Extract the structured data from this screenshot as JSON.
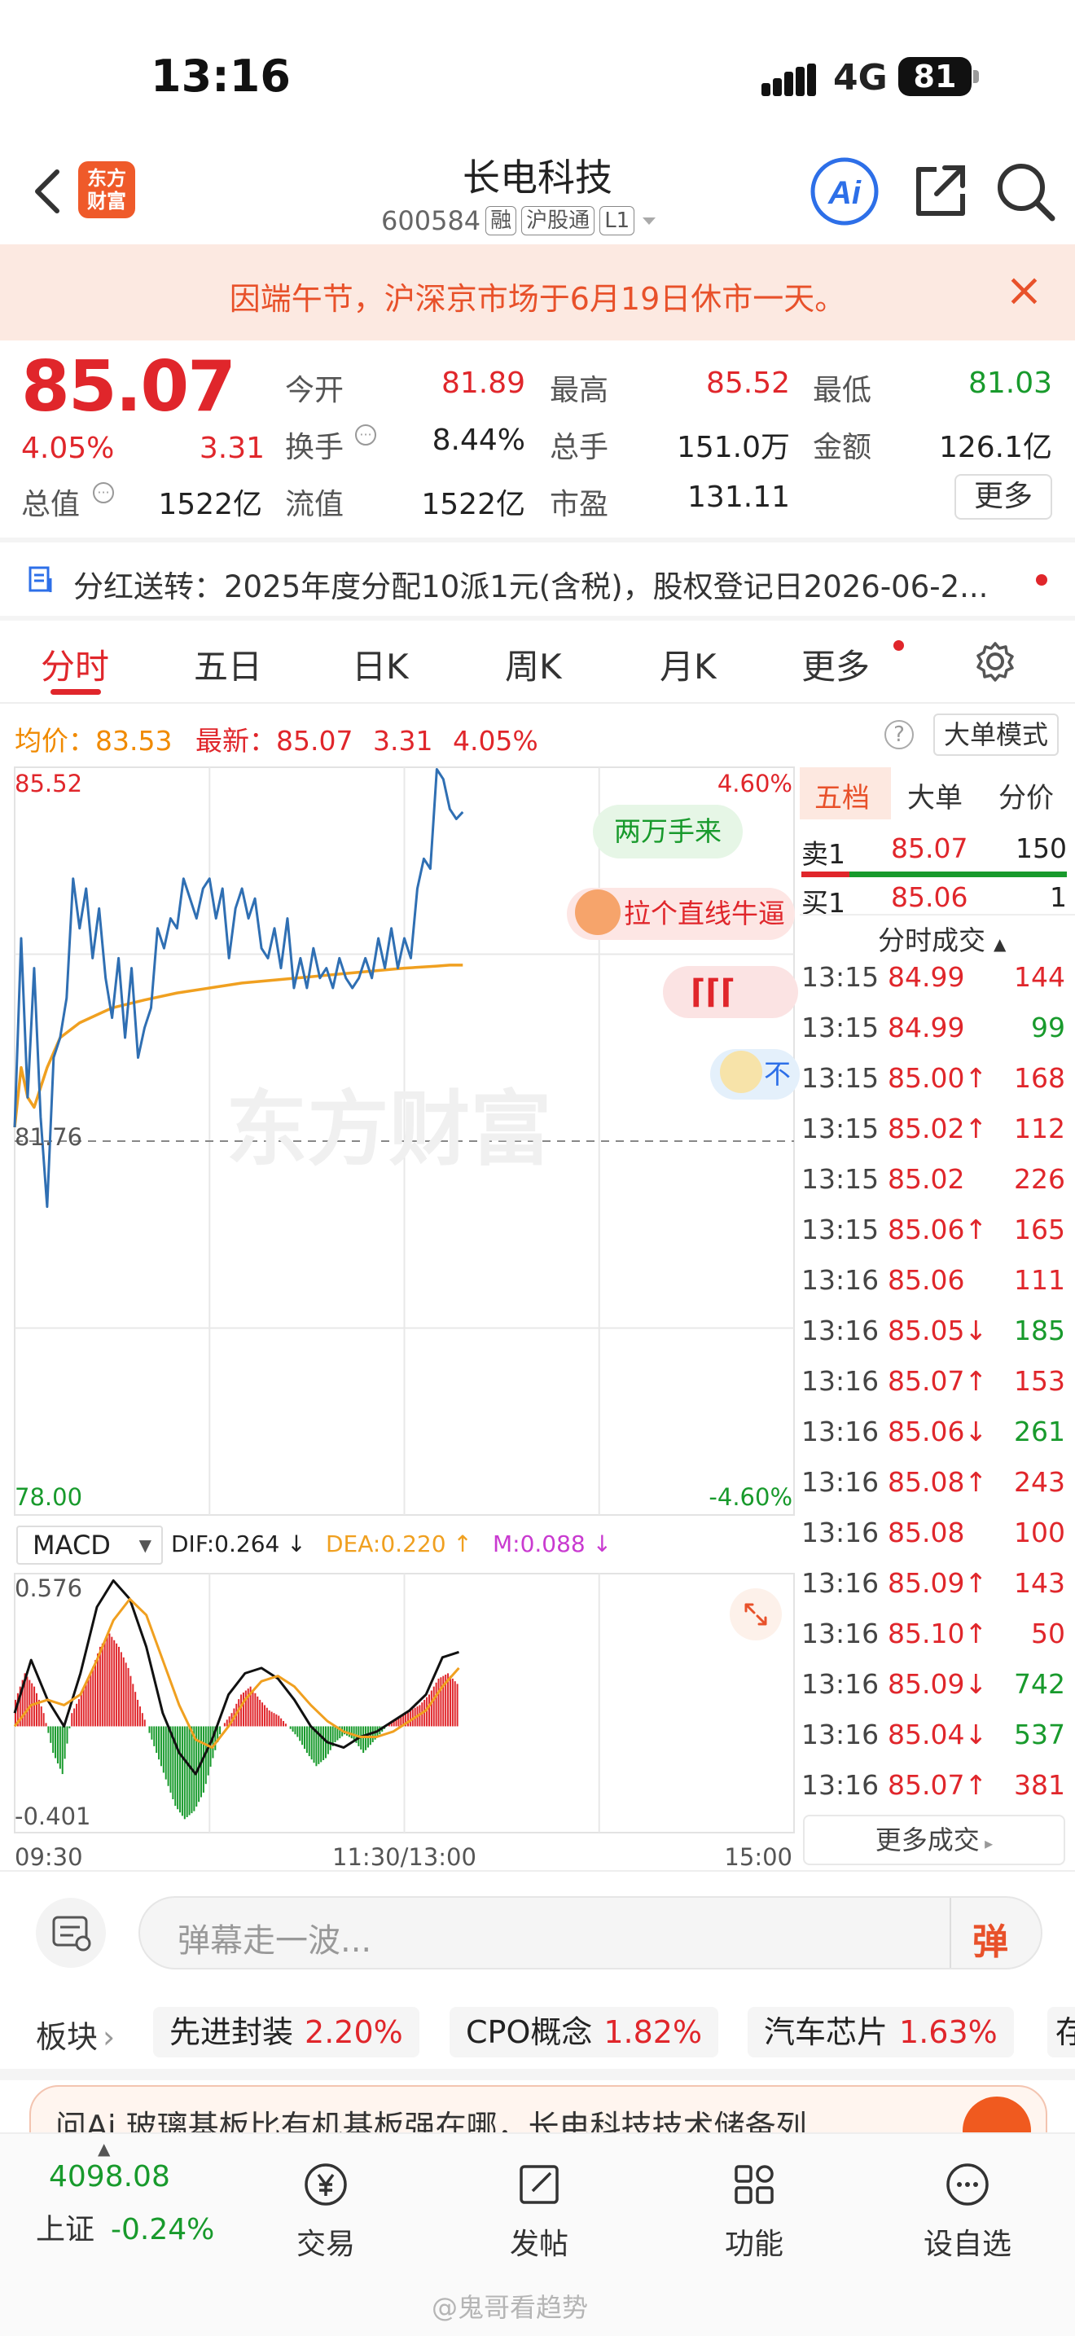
{
  "status_bar": {
    "time": "13:16",
    "network": "4G",
    "battery": "81"
  },
  "header": {
    "logo_line1": "东方",
    "logo_line2": "财富",
    "title": "长电科技",
    "code": "600584",
    "tags": [
      "融",
      "沪股通",
      "L1"
    ]
  },
  "notice": {
    "text": "因端午节，沪深京市场于6月19日休市一天。"
  },
  "quote": {
    "price": "85.07",
    "change_pct": "4.05%",
    "change": "3.31",
    "open_label": "今开",
    "open": "81.89",
    "high_label": "最高",
    "high": "85.52",
    "low_label": "最低",
    "low": "81.03",
    "turnover_label": "换手",
    "turnover": "8.44%",
    "volume_label": "总手",
    "volume": "151.0万",
    "amount_label": "金额",
    "amount": "126.1亿",
    "total_mv_label": "总值",
    "total_mv": "1522亿",
    "float_mv_label": "流值",
    "float_mv": "1522亿",
    "pe_label": "市盈",
    "pe": "131.11",
    "more_label": "更多"
  },
  "dividend": {
    "text": "分红送转：2025年度分配10派1元(含税)，股权登记日2026-06-2..."
  },
  "tabs": [
    "分时",
    "五日",
    "日K",
    "周K",
    "月K",
    "更多"
  ],
  "price_line": {
    "avg_label": "均价：",
    "avg": "83.53",
    "last_label": "最新：",
    "last": "85.07",
    "chg": "3.31",
    "pct": "4.05%",
    "big_order_label": "大单模式"
  },
  "chart_data": [
    {
      "type": "line",
      "x_labels": [
        "09:30",
        "11:30/13:00",
        "15:00"
      ],
      "yleft_labels": {
        "top": "85.52",
        "mid": "81.76",
        "bottom": "78.00"
      },
      "yright_labels": {
        "top": "4.60%",
        "bottom": "-4.60%"
      },
      "ylim": [
        78.0,
        85.52
      ],
      "prev_close": 81.76,
      "watermark": "东方财富",
      "series": [
        {
          "name": "",
          "color": "#2f6fb3",
          "x": [
            0,
            2,
            4,
            6,
            8,
            10,
            12,
            14,
            16,
            18,
            20,
            22,
            24,
            26,
            28,
            30,
            32,
            34,
            36,
            38,
            40,
            42,
            44,
            46,
            48,
            50,
            52,
            54,
            56,
            58,
            60,
            62,
            64,
            66,
            68,
            70,
            72,
            74,
            76,
            78,
            80,
            82,
            84,
            86,
            88,
            90,
            92,
            94,
            96,
            98,
            100,
            102,
            104,
            106,
            108,
            110,
            112,
            114,
            116,
            118,
            120,
            122,
            124,
            126,
            128,
            130,
            132,
            134,
            136,
            138
          ],
          "values": [
            81.9,
            83.8,
            82.2,
            83.5,
            82.0,
            81.1,
            82.6,
            82.8,
            83.2,
            84.4,
            83.9,
            84.3,
            83.6,
            84.1,
            83.4,
            83.0,
            83.6,
            82.8,
            83.5,
            82.6,
            82.9,
            83.1,
            83.9,
            83.7,
            84.0,
            83.9,
            84.4,
            84.2,
            84.0,
            84.3,
            84.4,
            84.0,
            84.3,
            83.6,
            84.1,
            84.3,
            84.0,
            84.2,
            83.7,
            83.6,
            83.9,
            83.5,
            84.0,
            83.3,
            83.6,
            83.3,
            83.7,
            83.4,
            83.5,
            83.3,
            83.6,
            83.4,
            83.3,
            83.4,
            83.6,
            83.4,
            83.8,
            83.5,
            83.9,
            83.5,
            83.8,
            83.6,
            84.3,
            84.6,
            84.5,
            85.5,
            85.4,
            85.1,
            85.0,
            85.07
          ]
        },
        {
          "name": "",
          "color": "#f0a020",
          "x": [
            0,
            2,
            4,
            6,
            8,
            10,
            14,
            20,
            30,
            40,
            50,
            60,
            70,
            80,
            90,
            100,
            110,
            120,
            130,
            134,
            138
          ],
          "values": [
            81.9,
            82.5,
            82.2,
            82.1,
            82.3,
            82.5,
            82.8,
            82.95,
            83.1,
            83.18,
            83.25,
            83.3,
            83.35,
            83.38,
            83.41,
            83.44,
            83.47,
            83.5,
            83.52,
            83.53,
            83.53
          ]
        }
      ]
    },
    {
      "type": "bar",
      "title": "MACD",
      "labels": {
        "dif": "DIF:0.264 ↓",
        "dea": "DEA:0.220 ↑",
        "m": "M:0.088 ↓"
      },
      "y_labels": {
        "top": "0.576",
        "bottom": "-0.401"
      },
      "ylim": [
        -0.401,
        0.576
      ],
      "bar_values": [
        0.1,
        0.2,
        0.15,
        0.05,
        -0.1,
        -0.18,
        0.05,
        0.12,
        0.2,
        0.3,
        0.35,
        0.3,
        0.22,
        0.1,
        0.0,
        -0.1,
        -0.2,
        -0.3,
        -0.35,
        -0.32,
        -0.25,
        -0.12,
        0.0,
        0.05,
        0.12,
        0.15,
        0.1,
        0.06,
        0.04,
        0.0,
        -0.04,
        -0.1,
        -0.15,
        -0.12,
        -0.06,
        -0.03,
        -0.05,
        -0.1,
        -0.06,
        -0.02,
        0.02,
        0.04,
        0.06,
        0.08,
        0.12,
        0.18,
        0.2,
        0.16
      ],
      "series": [
        {
          "name": "",
          "color": "#111111",
          "values": [
            0.05,
            0.25,
            0.1,
            0.0,
            0.2,
            0.45,
            0.55,
            0.48,
            0.3,
            0.05,
            -0.1,
            -0.18,
            -0.05,
            0.12,
            0.2,
            0.22,
            0.18,
            0.1,
            0.0,
            -0.06,
            -0.08,
            -0.04,
            -0.02,
            0.02,
            0.06,
            0.12,
            0.26,
            0.28
          ]
        },
        {
          "name": "",
          "color": "#f0a020",
          "values": [
            0.0,
            0.08,
            0.1,
            0.08,
            0.12,
            0.25,
            0.4,
            0.48,
            0.42,
            0.25,
            0.08,
            -0.05,
            -0.08,
            0.0,
            0.1,
            0.17,
            0.19,
            0.15,
            0.08,
            0.02,
            -0.02,
            -0.04,
            -0.04,
            -0.02,
            0.02,
            0.06,
            0.15,
            0.22
          ]
        }
      ]
    }
  ],
  "chips": {
    "c1": "两万手来",
    "c2": "拉个直线牛逼",
    "c4": "不"
  },
  "right_panel": {
    "tabs": [
      "五档",
      "大单",
      "分价"
    ],
    "sell1_label": "卖1",
    "sell1_price": "85.07",
    "sell1_vol": "150",
    "buy1_label": "买1",
    "buy1_price": "85.06",
    "buy1_vol": "1",
    "deals_title": "分时成交",
    "deals": [
      {
        "t": "13:15",
        "p": "84.99",
        "v": "144",
        "pc": "#e0262b",
        "vc": "#e0262b"
      },
      {
        "t": "13:15",
        "p": "84.99",
        "v": "99",
        "pc": "#e0262b",
        "vc": "#189a2c"
      },
      {
        "t": "13:15",
        "p": "85.00↑",
        "v": "168",
        "pc": "#e0262b",
        "vc": "#e0262b"
      },
      {
        "t": "13:15",
        "p": "85.02↑",
        "v": "112",
        "pc": "#e0262b",
        "vc": "#e0262b"
      },
      {
        "t": "13:15",
        "p": "85.02",
        "v": "226",
        "pc": "#e0262b",
        "vc": "#e0262b"
      },
      {
        "t": "13:15",
        "p": "85.06↑",
        "v": "165",
        "pc": "#e0262b",
        "vc": "#e0262b"
      },
      {
        "t": "13:16",
        "p": "85.06",
        "v": "111",
        "pc": "#e0262b",
        "vc": "#e0262b"
      },
      {
        "t": "13:16",
        "p": "85.05↓",
        "v": "185",
        "pc": "#e0262b",
        "vc": "#189a2c"
      },
      {
        "t": "13:16",
        "p": "85.07↑",
        "v": "153",
        "pc": "#e0262b",
        "vc": "#e0262b"
      },
      {
        "t": "13:16",
        "p": "85.06↓",
        "v": "261",
        "pc": "#e0262b",
        "vc": "#189a2c"
      },
      {
        "t": "13:16",
        "p": "85.08↑",
        "v": "243",
        "pc": "#e0262b",
        "vc": "#e0262b"
      },
      {
        "t": "13:16",
        "p": "85.08",
        "v": "100",
        "pc": "#e0262b",
        "vc": "#e0262b"
      },
      {
        "t": "13:16",
        "p": "85.09↑",
        "v": "143",
        "pc": "#e0262b",
        "vc": "#e0262b"
      },
      {
        "t": "13:16",
        "p": "85.10↑",
        "v": "50",
        "pc": "#e0262b",
        "vc": "#e0262b"
      },
      {
        "t": "13:16",
        "p": "85.09↓",
        "v": "742",
        "pc": "#e0262b",
        "vc": "#189a2c"
      },
      {
        "t": "13:16",
        "p": "85.04↓",
        "v": "537",
        "pc": "#e0262b",
        "vc": "#189a2c"
      },
      {
        "t": "13:16",
        "p": "85.07↑",
        "v": "381",
        "pc": "#e0262b",
        "vc": "#e0262b"
      }
    ],
    "more_deals": "更多成交"
  },
  "danmu": {
    "placeholder": "弹幕走一波...",
    "send_label": "弹"
  },
  "sectors": {
    "label": "板块",
    "items": [
      {
        "name": "先进封装",
        "pct": "2.20%"
      },
      {
        "name": "CPO概念",
        "pct": "1.82%"
      },
      {
        "name": "汽车芯片",
        "pct": "1.63%"
      },
      {
        "name": "存",
        "pct": ""
      }
    ]
  },
  "promo": {
    "text": "问Ai  玻璃基板比有机基板强在哪，长电科技技术储备列"
  },
  "bottom_nav": {
    "index_value": "4098.08",
    "index_name": "上证",
    "index_pct": "-0.24%",
    "items": [
      "交易",
      "发帖",
      "功能",
      "设自选"
    ]
  },
  "watermark": "@鬼哥看趋势",
  "colors": {
    "up": "#e0262b",
    "down": "#189a2c",
    "avg_line": "#f0a020",
    "price_line": "#2f6fb3",
    "accent": "#e8512a"
  }
}
